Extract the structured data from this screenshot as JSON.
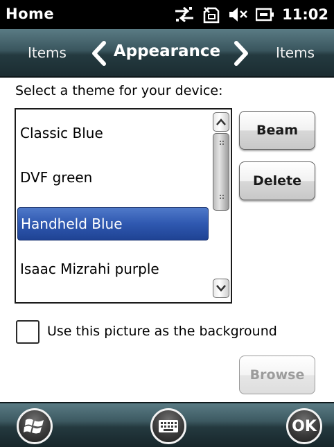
{
  "statusbar": {
    "title": "Home",
    "clock": "11:02",
    "icons": [
      "connectivity-icon",
      "no-sim-icon",
      "speaker-muted-icon",
      "battery-charging-icon"
    ]
  },
  "navbar": {
    "prev_label": "Items",
    "title": "Appearance",
    "next_label": "Items"
  },
  "content": {
    "prompt": "Select a theme for your device:",
    "themes": [
      {
        "label": "Classic Blue",
        "selected": false
      },
      {
        "label": "DVF green",
        "selected": false
      },
      {
        "label": "Handheld Blue",
        "selected": true
      },
      {
        "label": "Isaac Mizrahi purple",
        "selected": false
      }
    ],
    "beam_label": "Beam",
    "delete_label": "Delete",
    "checkbox_label": "Use this picture as the background",
    "checkbox_checked": false,
    "browse_label": "Browse",
    "browse_enabled": false
  },
  "softbar": {
    "ok_label": "OK"
  },
  "colors": {
    "selection": "#2f58b0",
    "bar_top": "#5a7b84",
    "bar_bottom": "#1b2c31"
  }
}
